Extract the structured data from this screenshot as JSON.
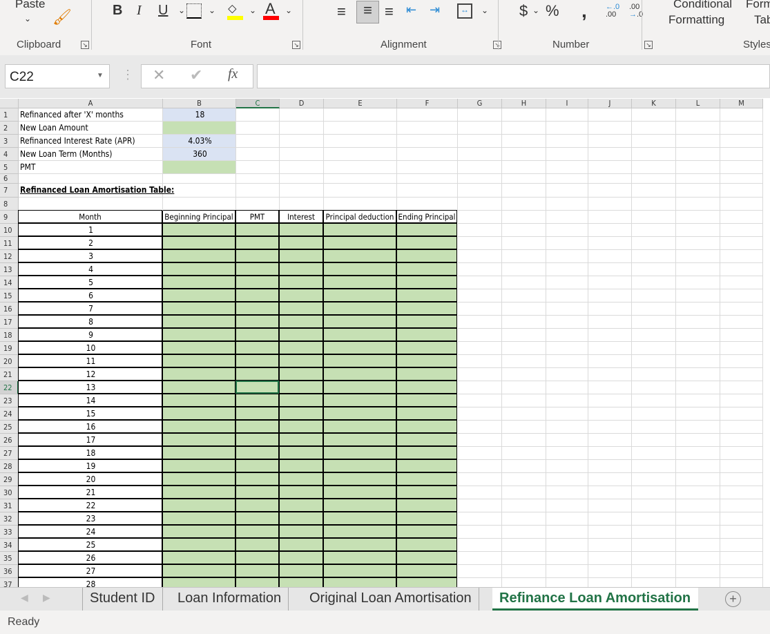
{
  "ribbon": {
    "paste_label": "Paste",
    "groups": {
      "clipboard": "Clipboard",
      "font": "Font",
      "alignment": "Alignment",
      "number": "Number",
      "styles": "Styles"
    },
    "conditional_formatting": [
      "Conditional",
      "Formatting"
    ],
    "format_as_table": [
      "Form",
      "Tab"
    ],
    "bold": "B",
    "italic": "I",
    "underline": "U",
    "currency": "$",
    "percent": "%",
    "comma": ",",
    "fill_color": "#ffff00",
    "font_color": "#ff0000"
  },
  "formula_bar": {
    "name_box": "C22",
    "fx": "fx",
    "formula": ""
  },
  "columns": [
    "A",
    "B",
    "C",
    "D",
    "E",
    "F",
    "G",
    "H",
    "I",
    "J",
    "K",
    "L",
    "M"
  ],
  "selected": {
    "cell": "C22",
    "column": "C",
    "row": 22
  },
  "inputs": [
    {
      "row": 1,
      "label": "Refinanced after 'X' months",
      "value": "18"
    },
    {
      "row": 2,
      "label": "New Loan Amount",
      "value": ""
    },
    {
      "row": 3,
      "label": "Refinanced Interest Rate (APR)",
      "value": "4.03%"
    },
    {
      "row": 4,
      "label": "New Loan Term (Months)",
      "value": "360"
    },
    {
      "row": 5,
      "label": "PMT",
      "value": ""
    }
  ],
  "table_title": "Refinanced Loan Amortisation Table:",
  "table_headers": [
    "Month",
    "Beginning Principal",
    "PMT",
    "Interest",
    "Principal deduction",
    "Ending Principal"
  ],
  "months": [
    "1",
    "2",
    "3",
    "4",
    "5",
    "6",
    "7",
    "8",
    "9",
    "10",
    "11",
    "12",
    "13",
    "14",
    "15",
    "16",
    "17",
    "18",
    "19",
    "20",
    "21",
    "22",
    "23",
    "24",
    "25",
    "26",
    "27",
    "28"
  ],
  "colors": {
    "input_blue": "#dae3f3",
    "output_green": "#c6e0b4",
    "accent": "#217346"
  },
  "sheet_tabs": [
    "Student ID",
    "Loan Information",
    "Original Loan Amortisation",
    "Refinance Loan Amortisation"
  ],
  "active_tab": "Refinance Loan Amortisation",
  "status": "Ready"
}
